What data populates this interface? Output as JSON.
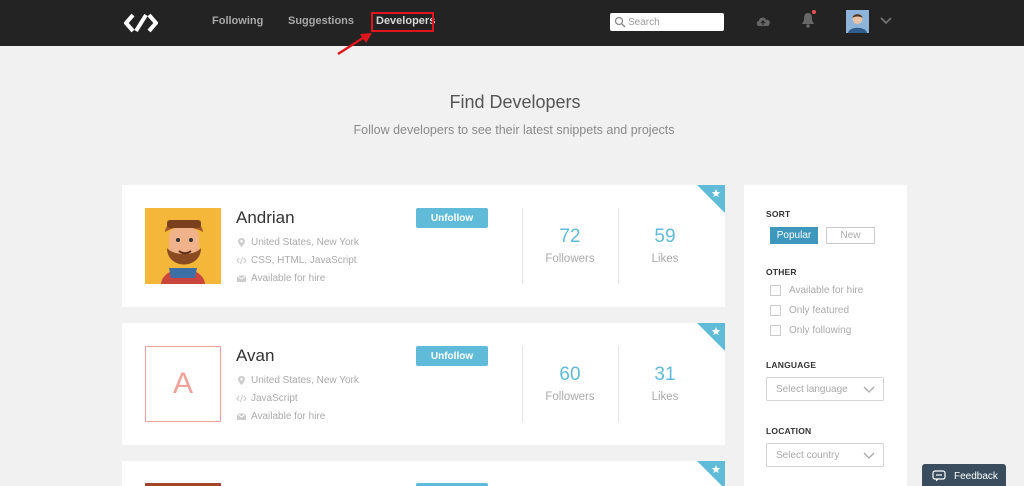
{
  "nav": {
    "logo_icon": "codepad-chevrons-logo",
    "links": [
      {
        "label": "Following"
      },
      {
        "label": "Suggestions"
      },
      {
        "label": "Developers",
        "active": true
      }
    ],
    "search_placeholder": "Search",
    "notification_dot_color": "#e9504e"
  },
  "header": {
    "title": "Find Developers",
    "subtitle": "Follow developers to see their latest snippets and projects"
  },
  "developers": [
    {
      "name": "Andrian",
      "location": "United States, New York",
      "skills": "CSS, HTML, JavaScript",
      "hire": "Available for hire",
      "button": "Unfollow",
      "followers": "72",
      "followers_label": "Followers",
      "likes": "59",
      "likes_label": "Likes",
      "featured": true
    },
    {
      "name": "Avan",
      "initial": "A",
      "location": "United States, New York",
      "skills": "JavaScript",
      "hire": "Available for hire",
      "button": "Unfollow",
      "followers": "60",
      "followers_label": "Followers",
      "likes": "31",
      "likes_label": "Likes",
      "featured": true
    },
    {
      "featured": true
    }
  ],
  "sidebar": {
    "sort_heading": "SORT",
    "sort_options": [
      "Popular",
      "New"
    ],
    "other_heading": "OTHER",
    "other_options": [
      "Available for hire",
      "Only featured",
      "Only following"
    ],
    "language_heading": "LANGUAGE",
    "language_placeholder": "Select language",
    "location_heading": "LOCATION",
    "location_placeholder": "Select country"
  },
  "feedback": {
    "label": "Feedback"
  },
  "colors": {
    "accent": "#5fbbd8",
    "sort_active": "#3e97bd",
    "topbar": "#232323",
    "highlight": "#e0161c"
  }
}
